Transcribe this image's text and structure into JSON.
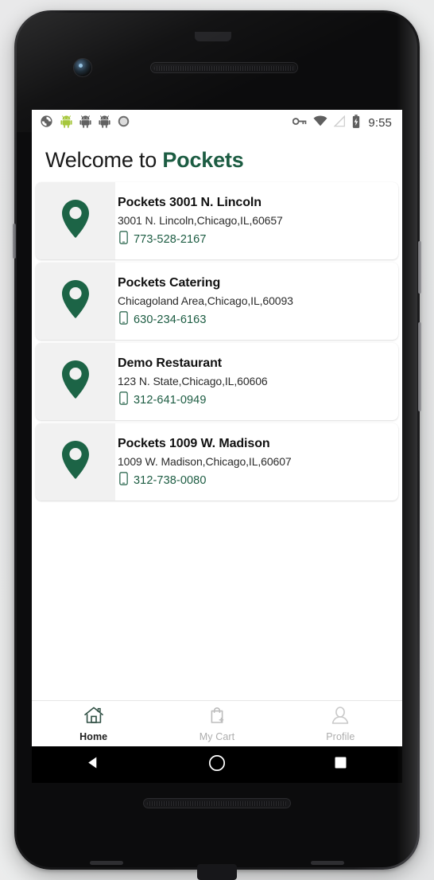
{
  "status_bar": {
    "left_icons": [
      "sync-icon",
      "android-green-icon",
      "android-gray-icon",
      "android-gray-icon-2",
      "circle-icon"
    ],
    "right_icons": [
      "vpn-key-icon",
      "wifi-icon",
      "no-signal-icon",
      "battery-icon"
    ],
    "clock": "9:55"
  },
  "header": {
    "greeting": "Welcome to ",
    "brand": "Pockets"
  },
  "colors": {
    "brand_green": "#1c5c42",
    "icon_tile_bg": "#f1f1f1",
    "inactive_gray": "#adadad",
    "screen_bg": "#ffffff"
  },
  "locations": [
    {
      "pin_icon": "map-pin-icon",
      "name": "Pockets 3001 N. Lincoln",
      "address": "3001 N. Lincoln,Chicago,IL,60657",
      "phone_icon": "mobile-phone-icon",
      "phone": "773-528-2167"
    },
    {
      "pin_icon": "map-pin-icon",
      "name": "Pockets Catering",
      "address": "Chicagoland Area,Chicago,IL,60093",
      "phone_icon": "mobile-phone-icon",
      "phone": "630-234-6163"
    },
    {
      "pin_icon": "map-pin-icon",
      "name": "Demo Restaurant",
      "address": "123 N. State,Chicago,IL,60606",
      "phone_icon": "mobile-phone-icon",
      "phone": "312-641-0949"
    },
    {
      "pin_icon": "map-pin-icon",
      "name": "Pockets 1009 W. Madison",
      "address": "1009 W. Madison,Chicago,IL,60607",
      "phone_icon": "mobile-phone-icon",
      "phone": "312-738-0080"
    }
  ],
  "tab_bar": {
    "tabs": [
      {
        "label": "Home",
        "icon": "home-icon",
        "active": true
      },
      {
        "label": "My Cart",
        "icon": "shopping-bag-add-icon",
        "active": false
      },
      {
        "label": "Profile",
        "icon": "person-icon",
        "active": false
      }
    ]
  },
  "nav_bar": {
    "back": "back-triangle-icon",
    "home": "home-circle-icon",
    "recents": "recents-square-icon"
  }
}
